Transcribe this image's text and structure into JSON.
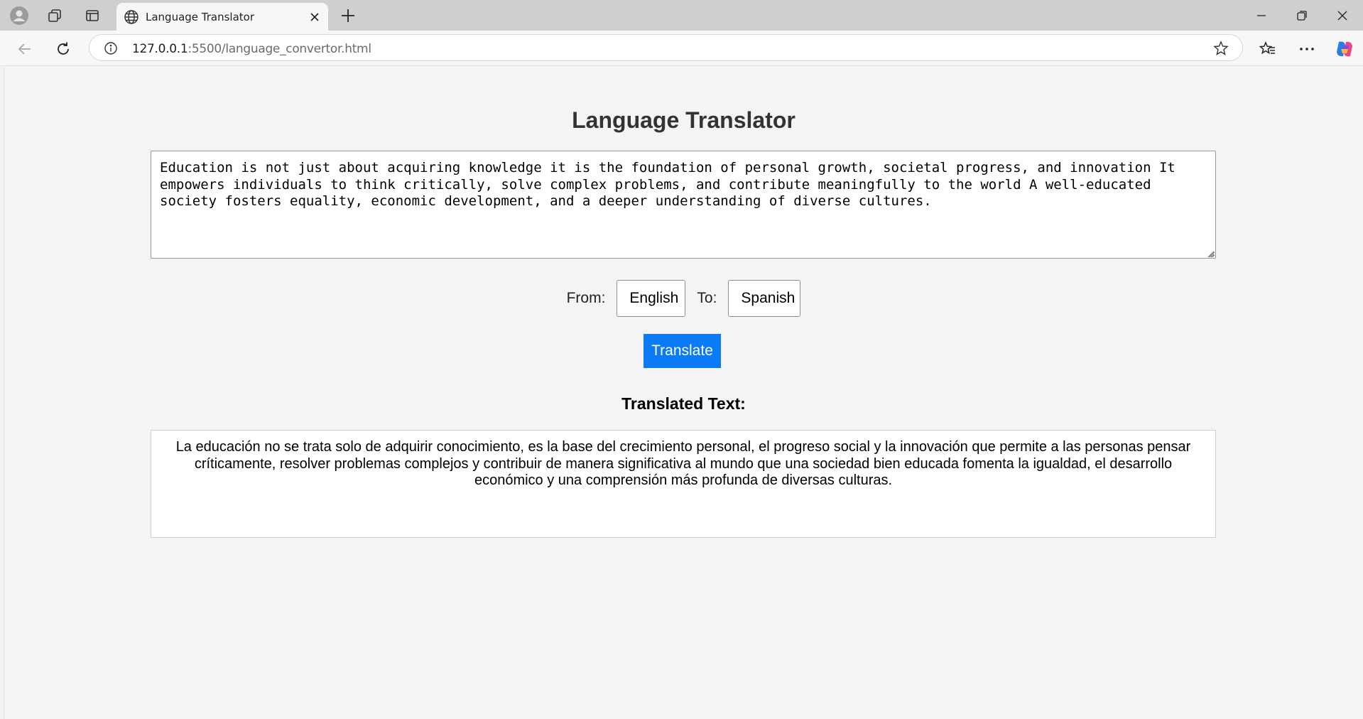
{
  "browser": {
    "tab_title": "Language Translator",
    "url_host": "127.0.0.1",
    "url_path": ":5500/language_convertor.html"
  },
  "page": {
    "title": "Language Translator",
    "source_text": "Education is not just about acquiring knowledge it is the foundation of personal growth, societal progress, and innovation It empowers individuals to think critically, solve complex problems, and contribute meaningfully to the world A well-educated society fosters equality, economic development, and a deeper understanding of diverse cultures.",
    "from_label": "From:",
    "to_label": "To:",
    "from_language": "English",
    "to_language": "Spanish",
    "translate_button": "Translate",
    "result_heading": "Translated Text:",
    "translated_text": "La educación no se trata solo de adquirir conocimiento, es la base del crecimiento personal, el progreso social y la innovación que permite a las personas pensar críticamente, resolver problemas complejos y contribuir de manera significativa al mundo que una sociedad bien educada fomenta la igualdad, el desarrollo económico y una comprensión más profunda de diversas culturas."
  },
  "colors": {
    "accent": "#0a7bf5",
    "page_background": "#f4f4f4"
  },
  "icons": [
    "profile-icon",
    "collections-icon",
    "tab-actions-icon",
    "globe-icon",
    "close-icon",
    "plus-icon",
    "minimize-icon",
    "restore-icon",
    "back-icon",
    "refresh-icon",
    "info-icon",
    "star-icon",
    "favorites-icon",
    "more-icon",
    "copilot-icon",
    "chevron-down-icon"
  ]
}
